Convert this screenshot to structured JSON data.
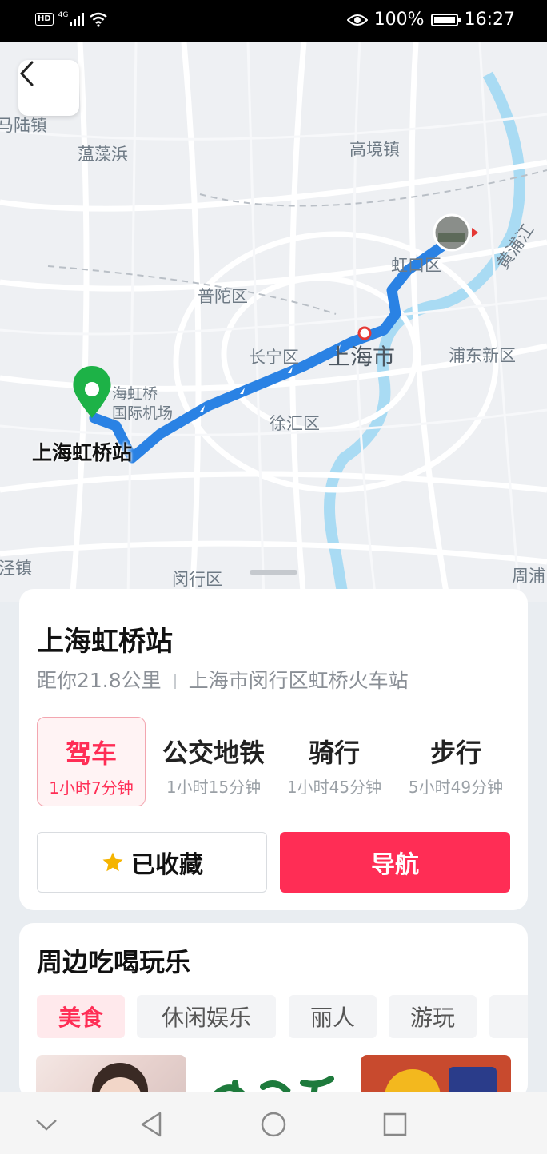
{
  "status_bar": {
    "hd": "HD",
    "network": "4G",
    "battery_percent": "100%",
    "time": "16:27"
  },
  "map": {
    "labels": {
      "malu": "马陆镇",
      "yunzaobang": "蕰藻浜",
      "gaojing": "高境镇",
      "hongkou": "虹口区",
      "huangpujiang": "黄浦江",
      "putuo": "普陀区",
      "changning": "长宁区",
      "shanghai": "上海市",
      "pudong": "浦东新区",
      "airport": "海虹桥\n国际机场",
      "xuhui": "徐汇区",
      "station": "上海虹桥站",
      "jingzhen": "泾镇",
      "minhang": "闵行区",
      "zhoupu": "周浦"
    },
    "route_color": "#2a82e4",
    "destination_pin_color": "#1db247"
  },
  "place": {
    "title": "上海虹桥站",
    "distance": "距你21.8公里",
    "address": "上海市闵行区虹桥火车站"
  },
  "modes": [
    {
      "label": "驾车",
      "time": "1小时7分钟",
      "active": true
    },
    {
      "label": "公交地铁",
      "time": "1小时15分钟",
      "active": false
    },
    {
      "label": "骑行",
      "time": "1小时45分钟",
      "active": false
    },
    {
      "label": "步行",
      "time": "5小时49分钟",
      "active": false
    }
  ],
  "buttons": {
    "favorite": "已收藏",
    "navigate": "导航"
  },
  "nearby": {
    "title": "周边吃喝玩乐",
    "tabs": [
      "美食",
      "休闲娱乐",
      "丽人",
      "游玩"
    ],
    "active_tab": "美食"
  },
  "colors": {
    "accent": "#ff2d55",
    "star": "#f5b400"
  }
}
